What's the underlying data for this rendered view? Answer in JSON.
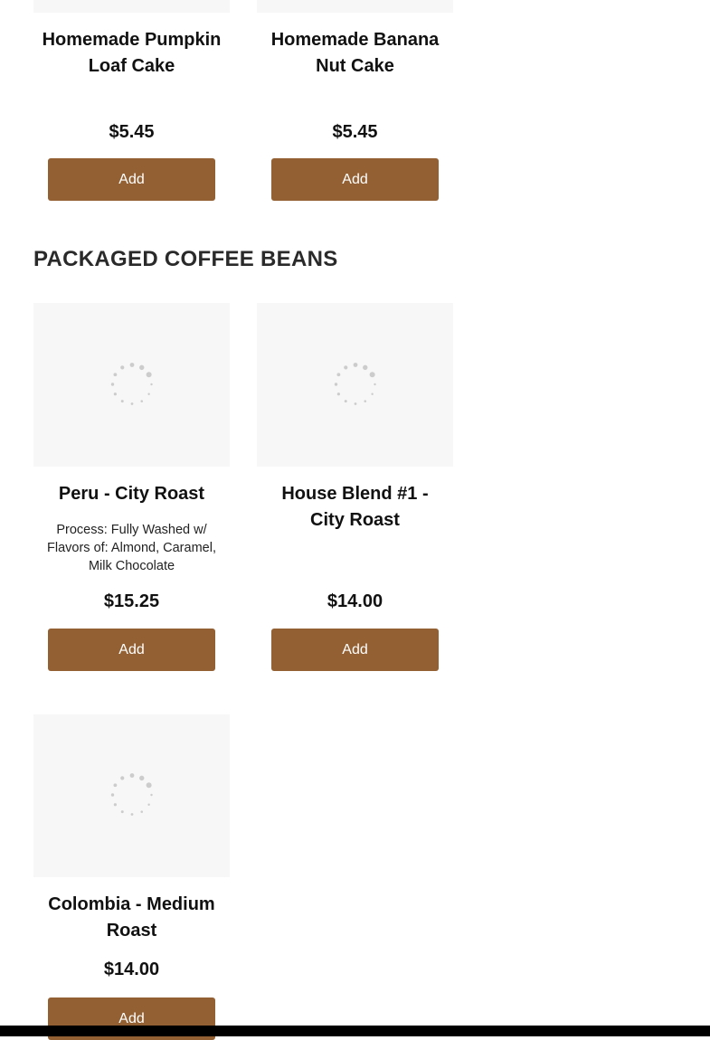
{
  "bakery": {
    "items": [
      {
        "name": "Homemade Pumpkin Loaf Cake",
        "price": "$5.45",
        "button": "Add"
      },
      {
        "name": "Homemade Banana Nut Cake",
        "price": "$5.45",
        "button": "Add"
      }
    ]
  },
  "coffee_beans": {
    "title": "PACKAGED COFFEE BEANS",
    "items": [
      {
        "name": "Peru - City Roast",
        "description": "Process: Fully Washed w/ Flavors of: Almond, Caramel, Milk Chocolate",
        "price": "$15.25",
        "button": "Add"
      },
      {
        "name": "House Blend #1 - City Roast",
        "price": "$14.00",
        "button": "Add"
      },
      {
        "name": "Colombia - Medium Roast",
        "price": "$14.00",
        "button": "Add"
      }
    ]
  },
  "colors": {
    "button_bg": "#936033",
    "image_placeholder_bg": "#f7f7f7",
    "spinner": "#cccccc"
  },
  "icons": {
    "image_loading": "loading-spinner-icon"
  }
}
